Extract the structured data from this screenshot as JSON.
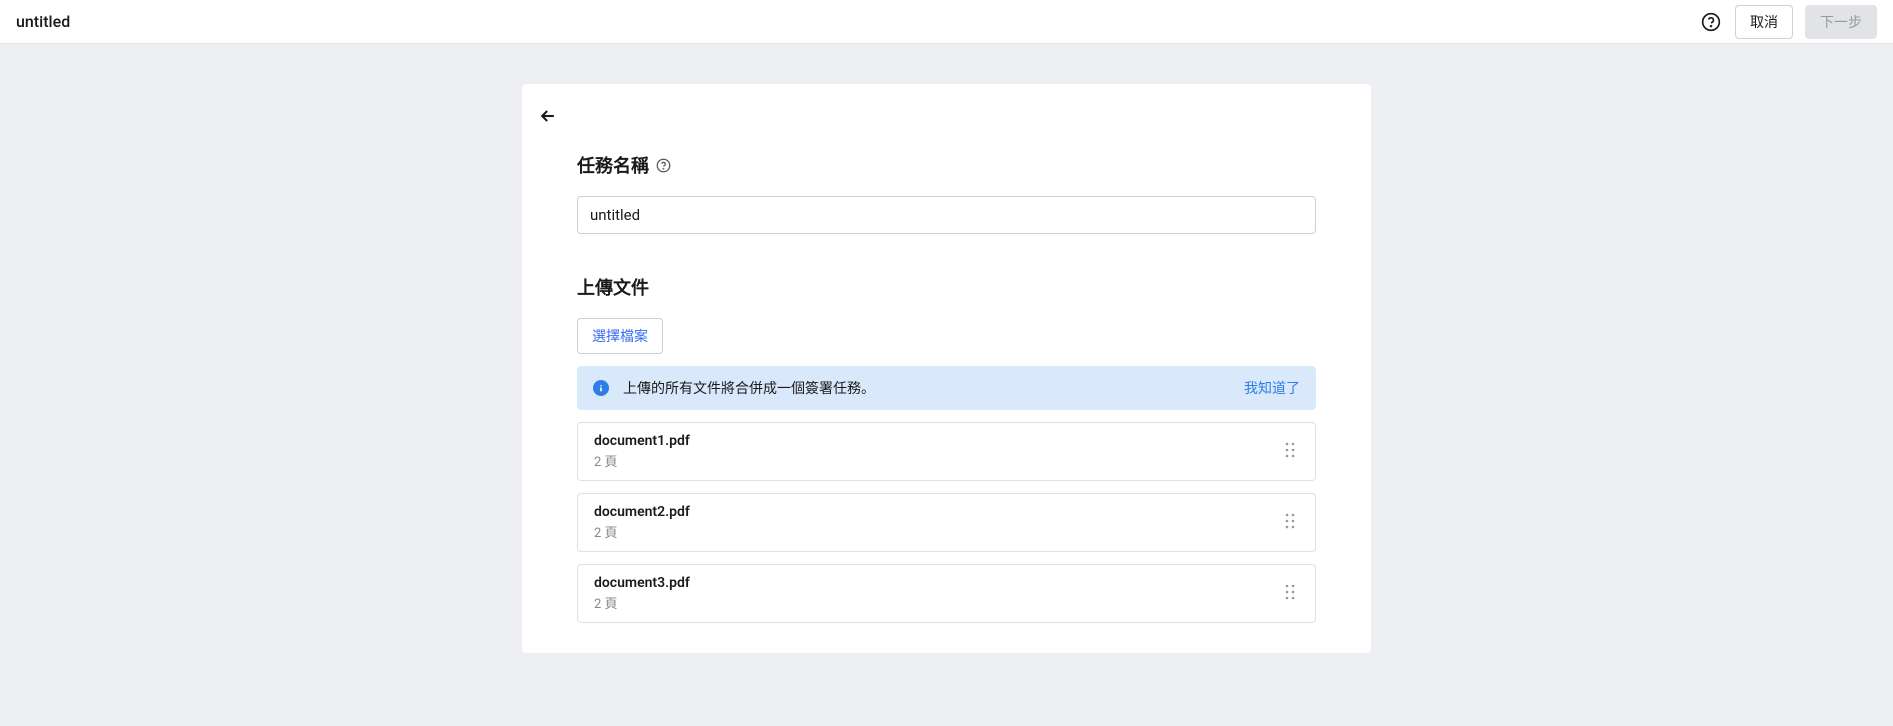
{
  "header": {
    "title": "untitled",
    "cancel_label": "取消",
    "next_label": "下一步"
  },
  "form": {
    "task_name_label": "任務名稱",
    "task_name_value": "untitled",
    "upload_label": "上傳文件",
    "select_file_label": "選擇檔案"
  },
  "alert": {
    "text": "上傳的所有文件將合併成一個簽署任務。",
    "action": "我知道了"
  },
  "files": [
    {
      "name": "document1.pdf",
      "pages": "2 頁"
    },
    {
      "name": "document2.pdf",
      "pages": "2 頁"
    },
    {
      "name": "document3.pdf",
      "pages": "2 頁"
    }
  ]
}
